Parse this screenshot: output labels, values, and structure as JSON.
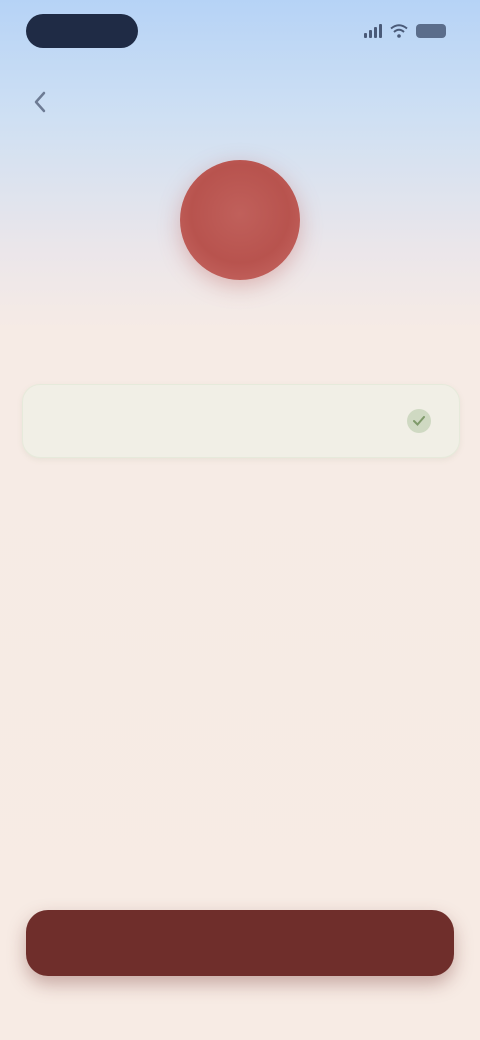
{
  "status_bar": {
    "time": "",
    "icons": [
      "signal-icon",
      "wifi-icon",
      "battery-icon"
    ]
  },
  "nav": {
    "back_icon": "chevron-left-icon",
    "title": ""
  },
  "profile": {
    "avatar_initials": "",
    "name": "",
    "subtitle": ""
  },
  "field": {
    "value": "",
    "placeholder": "",
    "icon": "check-icon"
  },
  "primary_button": {
    "label": ""
  },
  "colors": {
    "accent": "#6f2e2b",
    "avatar": "#b8534e",
    "background": "#f7ebe4",
    "header_sky": "#b6d3f6",
    "field_bg": "#f1efe6"
  }
}
